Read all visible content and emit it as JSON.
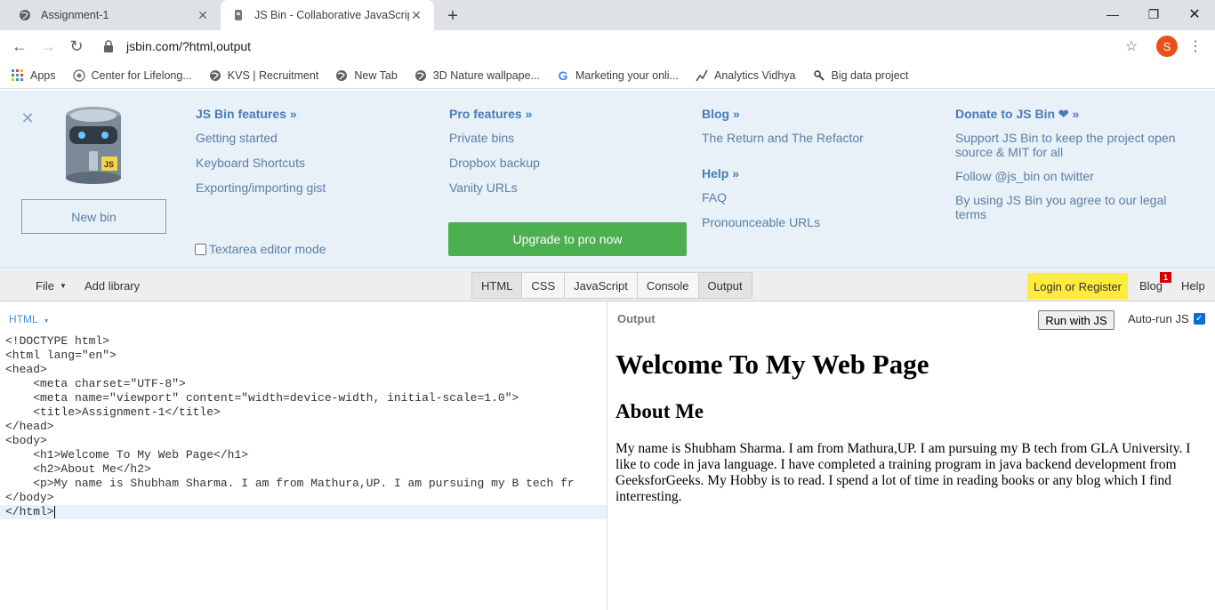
{
  "browser": {
    "tabs": [
      {
        "title": "Assignment-1",
        "icon": "globe-icon"
      },
      {
        "title": "JS Bin - Collaborative JavaScript Debugging",
        "icon": "jsbin-favicon-icon"
      }
    ],
    "url": "jsbin.com/?html,output",
    "profile_initial": "S",
    "bookmarks": [
      {
        "label": "Apps",
        "icon": "apps-grid-icon"
      },
      {
        "label": "Center for Lifelong...",
        "icon": "emblem-icon"
      },
      {
        "label": "KVS | Recruitment",
        "icon": "globe-icon"
      },
      {
        "label": "New Tab",
        "icon": "globe-icon"
      },
      {
        "label": "3D Nature wallpape...",
        "icon": "globe-icon"
      },
      {
        "label": "Marketing your onli...",
        "icon": "google-icon"
      },
      {
        "label": "Analytics Vidhya",
        "icon": "analytics-icon"
      },
      {
        "label": "Big data project",
        "icon": "data-icon"
      }
    ]
  },
  "info_panel": {
    "new_bin": "New bin",
    "textarea_mode": "Textarea editor mode",
    "upgrade": "Upgrade to pro now",
    "features": {
      "head": "JS Bin features »",
      "links": [
        "Getting started",
        "Keyboard Shortcuts",
        "Exporting/importing gist"
      ]
    },
    "pro": {
      "head": "Pro features »",
      "links": [
        "Private bins",
        "Dropbox backup",
        "Vanity URLs"
      ]
    },
    "blog": {
      "head": "Blog »",
      "links": [
        "The Return and The Refactor"
      ]
    },
    "help": {
      "head": "Help »",
      "links": [
        "FAQ",
        "Pronounceable URLs"
      ]
    },
    "donate": {
      "head": "Donate to JS Bin ❤ »",
      "links": [
        "Support JS Bin to keep the project open source & MIT for all",
        "Follow @js_bin on twitter",
        "By using JS Bin you agree to our legal terms"
      ]
    }
  },
  "jsbin_toolbar": {
    "file": "File",
    "add_library": "Add library",
    "panels": [
      "HTML",
      "CSS",
      "JavaScript",
      "Console",
      "Output"
    ],
    "active_panels": [
      "HTML",
      "Output"
    ],
    "login": "Login or Register",
    "blog": "Blog",
    "blog_badge": "1",
    "help": "Help"
  },
  "editor": {
    "language": "HTML",
    "lines": [
      "<!DOCTYPE html>",
      "<html lang=\"en\">",
      "<head>",
      "    <meta charset=\"UTF-8\">",
      "    <meta name=\"viewport\" content=\"width=device-width, initial-scale=1.0\">",
      "    <title>Assignment-1</title>",
      "</head>",
      "<body>",
      "    <h1>Welcome To My Web Page</h1>",
      "    <h2>About Me</h2>",
      "    <p>My name is Shubham Sharma. I am from Mathura,UP. I am pursuing my B tech fr",
      "</body>",
      "</html>"
    ]
  },
  "output": {
    "label": "Output",
    "run_button": "Run with JS",
    "autorun_label": "Auto-run JS",
    "autorun_checked": true,
    "h1": "Welcome To My Web Page",
    "h2": "About Me",
    "paragraph": "My name is Shubham Sharma. I am from Mathura,UP. I am pursuing my B tech from GLA University. I like to code in java language. I have completed a training program in java backend development from GeeksforGeeks. My Hobby is to read. I spend a lot of time in reading books or any blog which I find interresting."
  }
}
